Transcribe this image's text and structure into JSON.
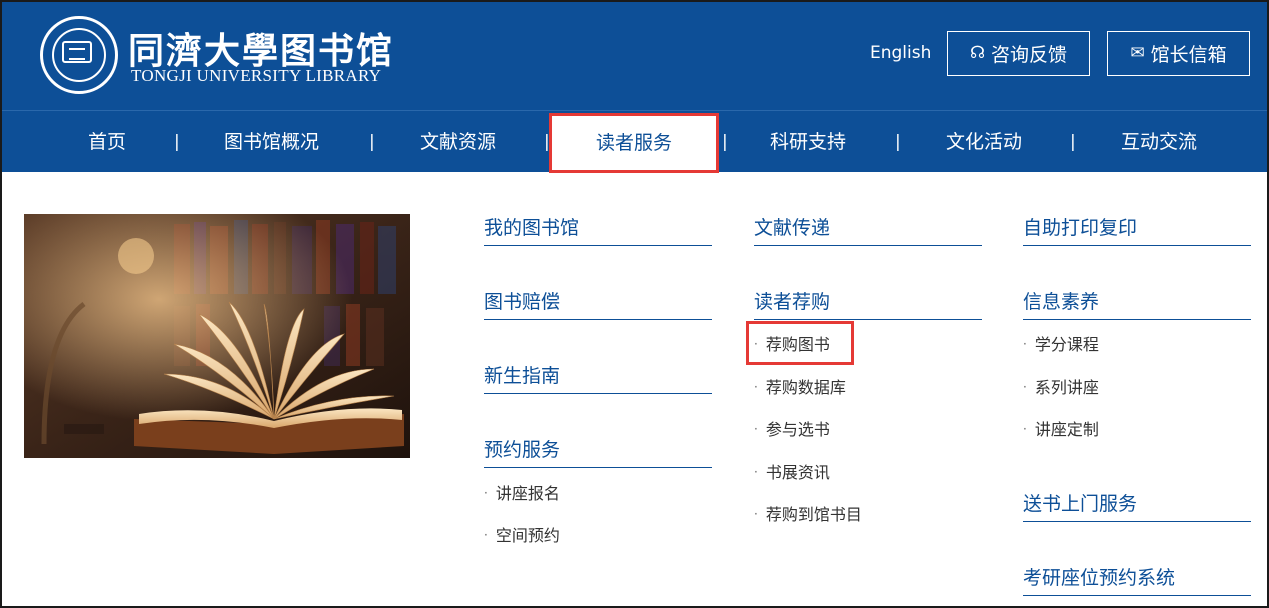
{
  "header": {
    "logo_title": "同濟大學图书馆",
    "logo_subtitle": "TONGJI UNIVERSITY LIBRARY",
    "language_link": "English",
    "consult_button": "咨询反馈",
    "mailbox_button": "馆长信箱",
    "brand_color": "#0d4f97"
  },
  "nav": {
    "items": [
      {
        "label": "首页"
      },
      {
        "label": "图书馆概况"
      },
      {
        "label": "文献资源"
      },
      {
        "label": "读者服务",
        "active": true
      },
      {
        "label": "科研支持"
      },
      {
        "label": "文化活动"
      },
      {
        "label": "互动交流"
      }
    ],
    "separator": "|",
    "highlight_color": "#e53935"
  },
  "menu": {
    "col1": {
      "groups": [
        {
          "title": "我的图书馆",
          "items": []
        },
        {
          "title": "图书赔偿",
          "items": []
        },
        {
          "title": "新生指南",
          "items": []
        },
        {
          "title": "预约服务",
          "items": [
            "讲座报名",
            "空间预约"
          ]
        }
      ]
    },
    "col2": {
      "groups": [
        {
          "title": "文献传递",
          "items": []
        },
        {
          "title": "读者荐购",
          "items": [
            "荐购图书",
            "荐购数据库",
            "参与选书",
            "书展资讯",
            "荐购到馆书目"
          ]
        }
      ]
    },
    "col3": {
      "groups": [
        {
          "title": "自助打印复印",
          "items": []
        },
        {
          "title": "信息素养",
          "items": [
            "学分课程",
            "系列讲座",
            "讲座定制"
          ]
        },
        {
          "title": "送书上门服务",
          "items": []
        },
        {
          "title": "考研座位预约系统",
          "items": []
        }
      ]
    },
    "bullet": "·"
  }
}
